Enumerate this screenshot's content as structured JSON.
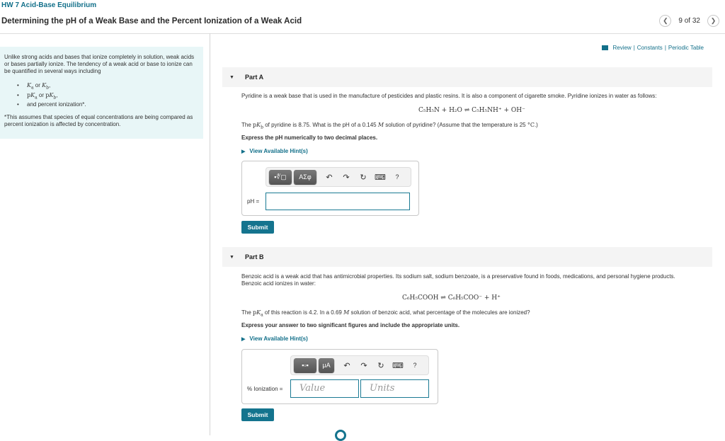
{
  "header": {
    "breadcrumb": "HW 7 Acid-Base Equilibrium",
    "title": "Determining the pH of a Weak Base and the Percent Ionization of a Weak Acid",
    "pager": {
      "prev_icon": "chevron-left-icon",
      "label": "9 of 32",
      "next_icon": "chevron-right-icon"
    }
  },
  "resources": {
    "icon": "book-icon",
    "review": "Review",
    "sep": "|",
    "constants": "Constants",
    "periodic_table": "Periodic Table"
  },
  "sidebar": {
    "intro": "Unlike strong acids and bases that ionize completely in solution, weak acids or bases partially ionize. The tendency of a weak acid or base to ionize can be quantified in several ways including",
    "items": [
      {
        "math": "Ka",
        "or": " or ",
        "math2": "Kb",
        "suffix": ","
      },
      {
        "math": "pKa",
        "or": " or ",
        "math2": "pKb",
        "suffix": ","
      },
      {
        "text": "and percent ionization*."
      }
    ],
    "footnote": "*This assumes that species of equal concentrations are being compared as percent ionization is affected by concentration."
  },
  "partA": {
    "label": "Part A",
    "intro": "Pyridine is a weak base that is used in the manufacture of pesticides and plastic resins. It is also a component of cigarette smoke. Pyridine ionizes in water as follows:",
    "equation": "C₅H₅N + H₂O ⇌ C₅H₅NH⁺ + OH⁻",
    "question": "The pK_b of pyridine is 8.75. What is the pH of a 0.145 M solution of pyridine?   (Assume that the temperature is 25 °C.)",
    "q_pre": "The ",
    "q_math": "pK",
    "q_sub": "b",
    "q_mid": " of pyridine is 8.75. What is the pH of a 0.145 ",
    "q_M": "M",
    "q_post": " solution of pyridine?   (Assume that the temperature is 25 ",
    "q_deg": "°C",
    "q_end": ".)",
    "instruction": "Express the pH numerically to two decimal places.",
    "hint": "View Available Hint(s)",
    "toolbar": {
      "template_btn": "▪∜▢",
      "greek_btn": "ΑΣφ",
      "undo": "↶",
      "redo": "↷",
      "reset": "↻",
      "keyboard": "⌨",
      "help": "?"
    },
    "input_label": "pH =",
    "input_value": "",
    "submit": "Submit"
  },
  "partB": {
    "label": "Part B",
    "intro": "Benzoic acid is a weak acid that has antimicrobial properties. Its sodium salt, sodium benzoate, is a preservative found in foods, medications, and personal hygiene products. Benzoic acid ionizes in water:",
    "equation": "C₆H₅COOH ⇌ C₆H₅COO⁻ + H⁺",
    "q_pre": "The ",
    "q_math": "pK",
    "q_sub": "a",
    "q_mid": " of this reaction is 4.2. In a 0.69 ",
    "q_M": "M",
    "q_post": " solution of benzoic acid, what percentage of the molecules are ionized?",
    "instruction": "Express your answer to two significant figures and include the appropriate units.",
    "hint": "View Available Hint(s)",
    "toolbar": {
      "template_btn": "▪▫▪",
      "units_btn": "μA",
      "undo": "↶",
      "redo": "↷",
      "reset": "↻",
      "keyboard": "⌨",
      "help": "?"
    },
    "input_label": "% Ionization =",
    "value_placeholder": "Value",
    "units_placeholder": "Units",
    "submit": "Submit"
  }
}
